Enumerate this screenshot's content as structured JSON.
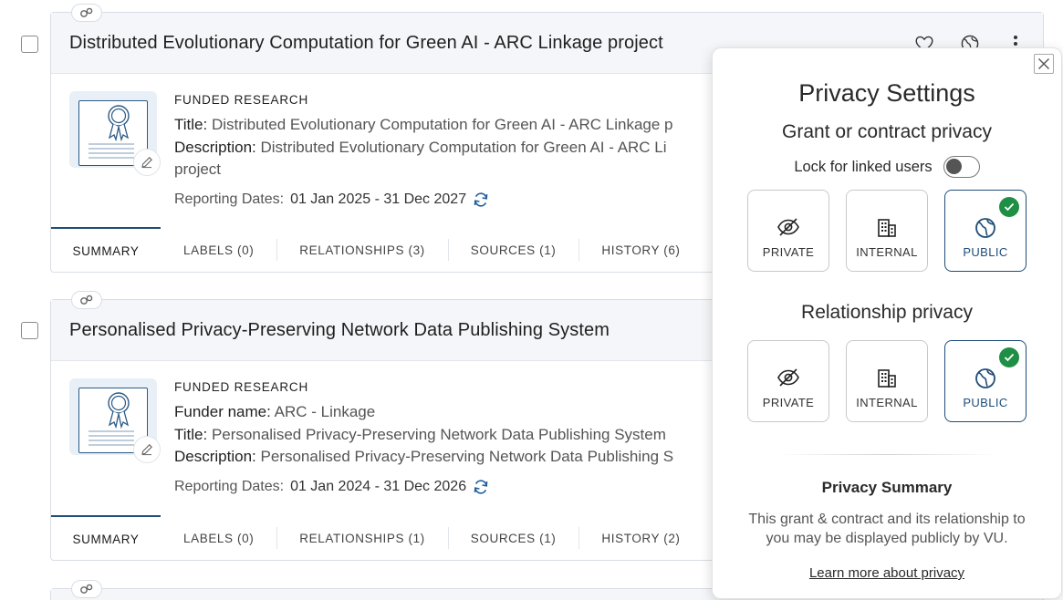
{
  "records": [
    {
      "title": "Distributed Evolutionary Computation for Green AI - ARC Linkage project",
      "kind": "FUNDED RESEARCH",
      "fields": [
        {
          "key": "Title:",
          "value": "Distributed Evolutionary Computation for Green AI - ARC Linkage p"
        },
        {
          "key": "Description:",
          "value": "Distributed Evolutionary Computation for Green AI - ARC Li"
        }
      ],
      "description_wrap": "project",
      "dates_label": "Reporting Dates:",
      "dates_value": "01 Jan 2025 - 31 Dec 2027",
      "tabs": [
        "SUMMARY",
        "LABELS (0)",
        "RELATIONSHIPS (3)",
        "SOURCES (1)",
        "HISTORY (6)"
      ]
    },
    {
      "title": "Personalised Privacy-Preserving Network Data Publishing System",
      "kind": "FUNDED RESEARCH",
      "fields": [
        {
          "key": "Funder name:",
          "value": "ARC - Linkage"
        },
        {
          "key": "Title:",
          "value": "Personalised Privacy-Preserving Network Data Publishing System"
        },
        {
          "key": "Description:",
          "value": "Personalised Privacy-Preserving Network Data Publishing S"
        }
      ],
      "dates_label": "Reporting Dates:",
      "dates_value": "01 Jan 2024 - 31 Dec 2026",
      "tabs": [
        "SUMMARY",
        "LABELS (0)",
        "RELATIONSHIPS (1)",
        "SOURCES (1)",
        "HISTORY (2)"
      ]
    }
  ],
  "privacy": {
    "title": "Privacy Settings",
    "grant_section": "Grant or contract privacy",
    "lock_label": "Lock for linked users",
    "lock_enabled": false,
    "grant_options": [
      {
        "label": "PRIVATE",
        "icon": "eye-off-icon",
        "selected": false
      },
      {
        "label": "INTERNAL",
        "icon": "building-icon",
        "selected": false
      },
      {
        "label": "PUBLIC",
        "icon": "globe-icon",
        "selected": true
      }
    ],
    "relationship_section": "Relationship privacy",
    "relationship_options": [
      {
        "label": "PRIVATE",
        "icon": "eye-off-icon",
        "selected": false
      },
      {
        "label": "INTERNAL",
        "icon": "building-icon",
        "selected": false
      },
      {
        "label": "PUBLIC",
        "icon": "globe-icon",
        "selected": true
      }
    ],
    "summary_title": "Privacy Summary",
    "summary_text": "This grant & contract and its relationship to you may be displayed publicly by VU.",
    "learn_more": "Learn more about privacy"
  },
  "colors": {
    "accent": "#1f4e79",
    "selected_check": "#1e8f45",
    "card_header_bg": "#f4f6f9"
  }
}
